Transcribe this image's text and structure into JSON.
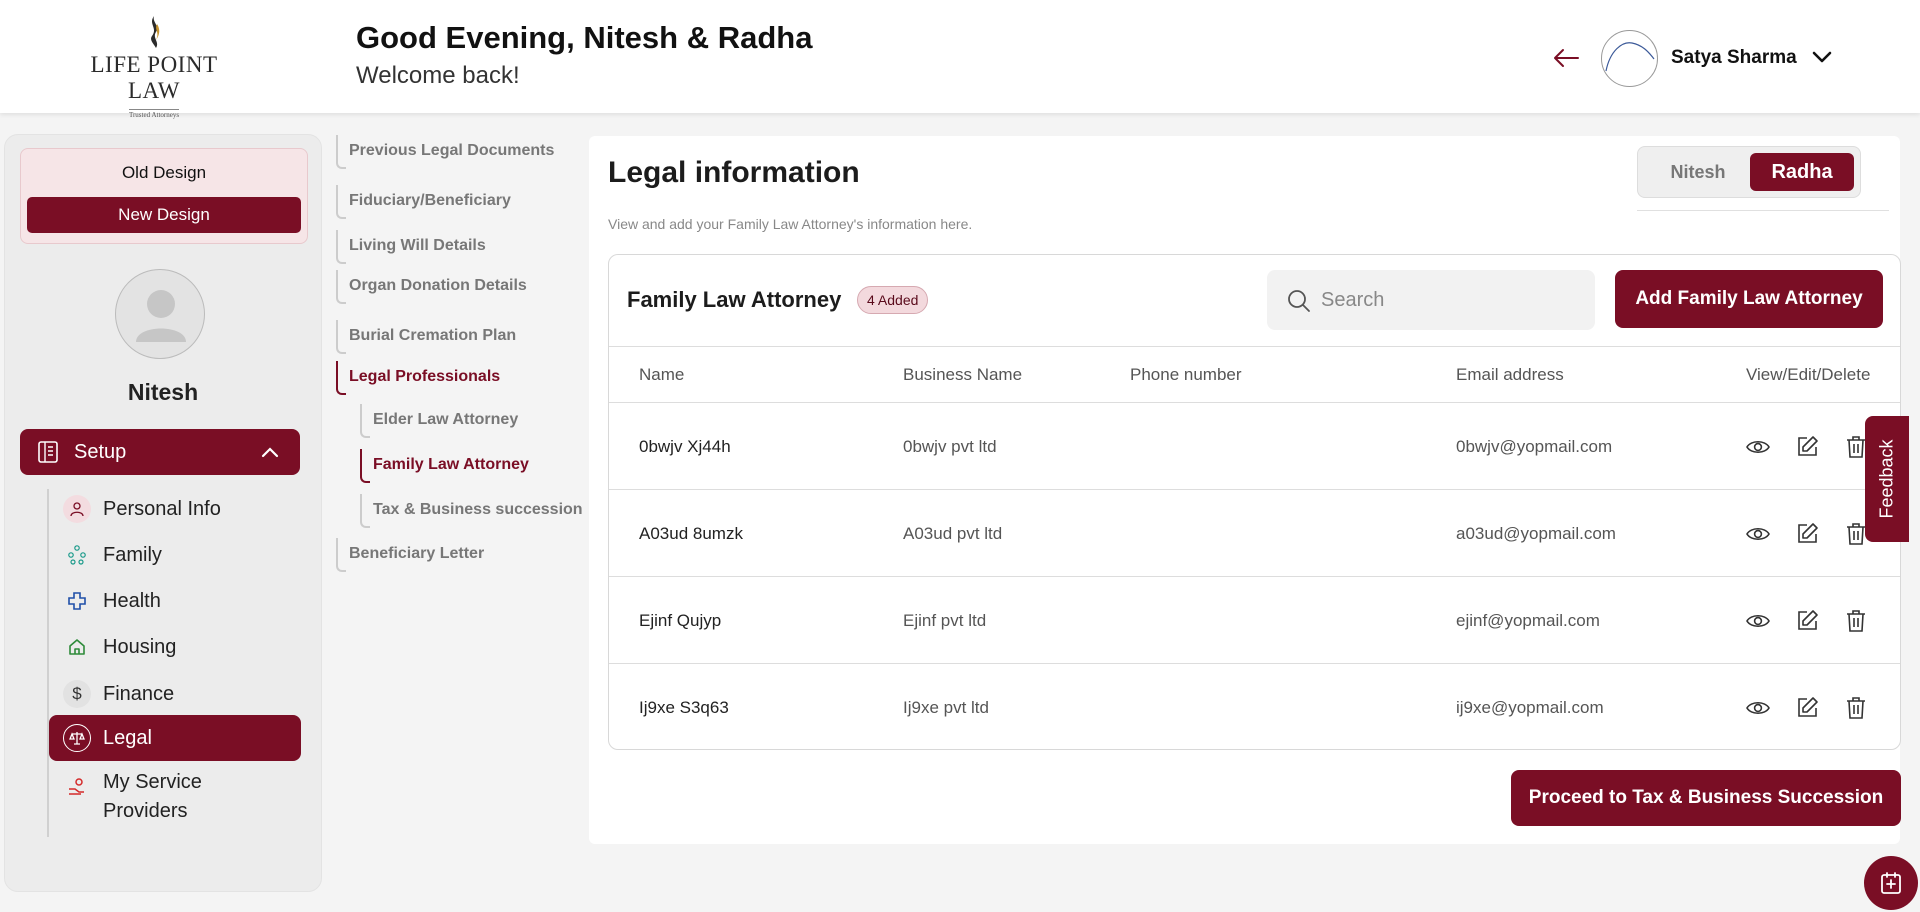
{
  "header": {
    "logo_text": "LIFE POINT LAW",
    "logo_tagline": "Trusted Attorneys",
    "greeting": "Good Evening, Nitesh & Radha",
    "welcome": "Welcome back!",
    "user_name": "Satya Sharma"
  },
  "sidebar": {
    "old_design": "Old Design",
    "new_design": "New Design",
    "profile_name": "Nitesh",
    "setup_label": "Setup",
    "items": [
      {
        "label": "Personal Info",
        "icon": "person-icon"
      },
      {
        "label": "Family",
        "icon": "family-tree-icon"
      },
      {
        "label": "Health",
        "icon": "health-cross-icon"
      },
      {
        "label": "Housing",
        "icon": "home-icon"
      },
      {
        "label": "Finance",
        "icon": "dollar-icon"
      },
      {
        "label": "Legal",
        "icon": "scales-icon"
      },
      {
        "label": "My Service Providers",
        "icon": "service-provider-icon"
      }
    ]
  },
  "steps": {
    "items": [
      "Previous Legal Documents",
      "Fiduciary/Beneficiary",
      "Living Will Details",
      "Organ Donation Details",
      "Burial Cremation Plan",
      "Legal Professionals",
      "Elder Law Attorney",
      "Family Law Attorney",
      "Tax & Business succession",
      "Beneficiary Letter"
    ]
  },
  "main": {
    "title": "Legal information",
    "subtitle": "View and add your Family Law Attorney's information here.",
    "spouse_tabs": [
      "Nitesh",
      "Radha"
    ],
    "card_title": "Family Law Attorney",
    "count_badge": "4 Added",
    "search_placeholder": "Search",
    "add_button": "Add Family Law Attorney",
    "columns": [
      "Name",
      "Business Name",
      "Phone number",
      "Email address",
      "View/Edit/Delete"
    ],
    "rows": [
      {
        "name": "0bwjv Xj44h",
        "business": "0bwjv pvt ltd",
        "phone": "",
        "email": "0bwjv@yopmail.com"
      },
      {
        "name": "A03ud 8umzk",
        "business": "A03ud pvt ltd",
        "phone": "",
        "email": "a03ud@yopmail.com"
      },
      {
        "name": "Ejinf Qujyp",
        "business": "Ejinf pvt ltd",
        "phone": "",
        "email": "ejinf@yopmail.com"
      },
      {
        "name": "Ij9xe S3q63",
        "business": "Ij9xe pvt ltd",
        "phone": "",
        "email": "ij9xe@yopmail.com"
      }
    ],
    "proceed_button": "Proceed to Tax & Business Succession"
  },
  "feedback_label": "Feedback",
  "colors": {
    "accent": "#7a0e25",
    "badge_bg": "#f3d9dd"
  }
}
